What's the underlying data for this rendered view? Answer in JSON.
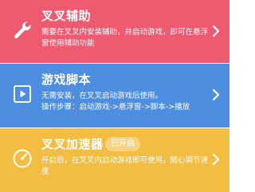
{
  "colors": {
    "card_assist": "#ee5a6f",
    "card_script": "#4d8ee0",
    "card_accelerator": "#f2bd41"
  },
  "cards": [
    {
      "title": "叉叉辅助",
      "description": "需要在叉叉内安装辅助，并启动游戏，即可在悬浮窗使用辅助功能",
      "icon": "wrench-icon"
    },
    {
      "title": "游戏脚本",
      "description_line1": "无需安装，在叉叉启动游戏后使用。",
      "description_line2": "操作步骤：启动游戏->悬浮窗->脚本->播放",
      "icon": "play-icon"
    },
    {
      "title": "叉叉加速器",
      "badge": "已开启",
      "description": "开启后，在叉叉内启动游戏即可使用，随心调节速度",
      "icon": "speedometer-icon"
    }
  ]
}
